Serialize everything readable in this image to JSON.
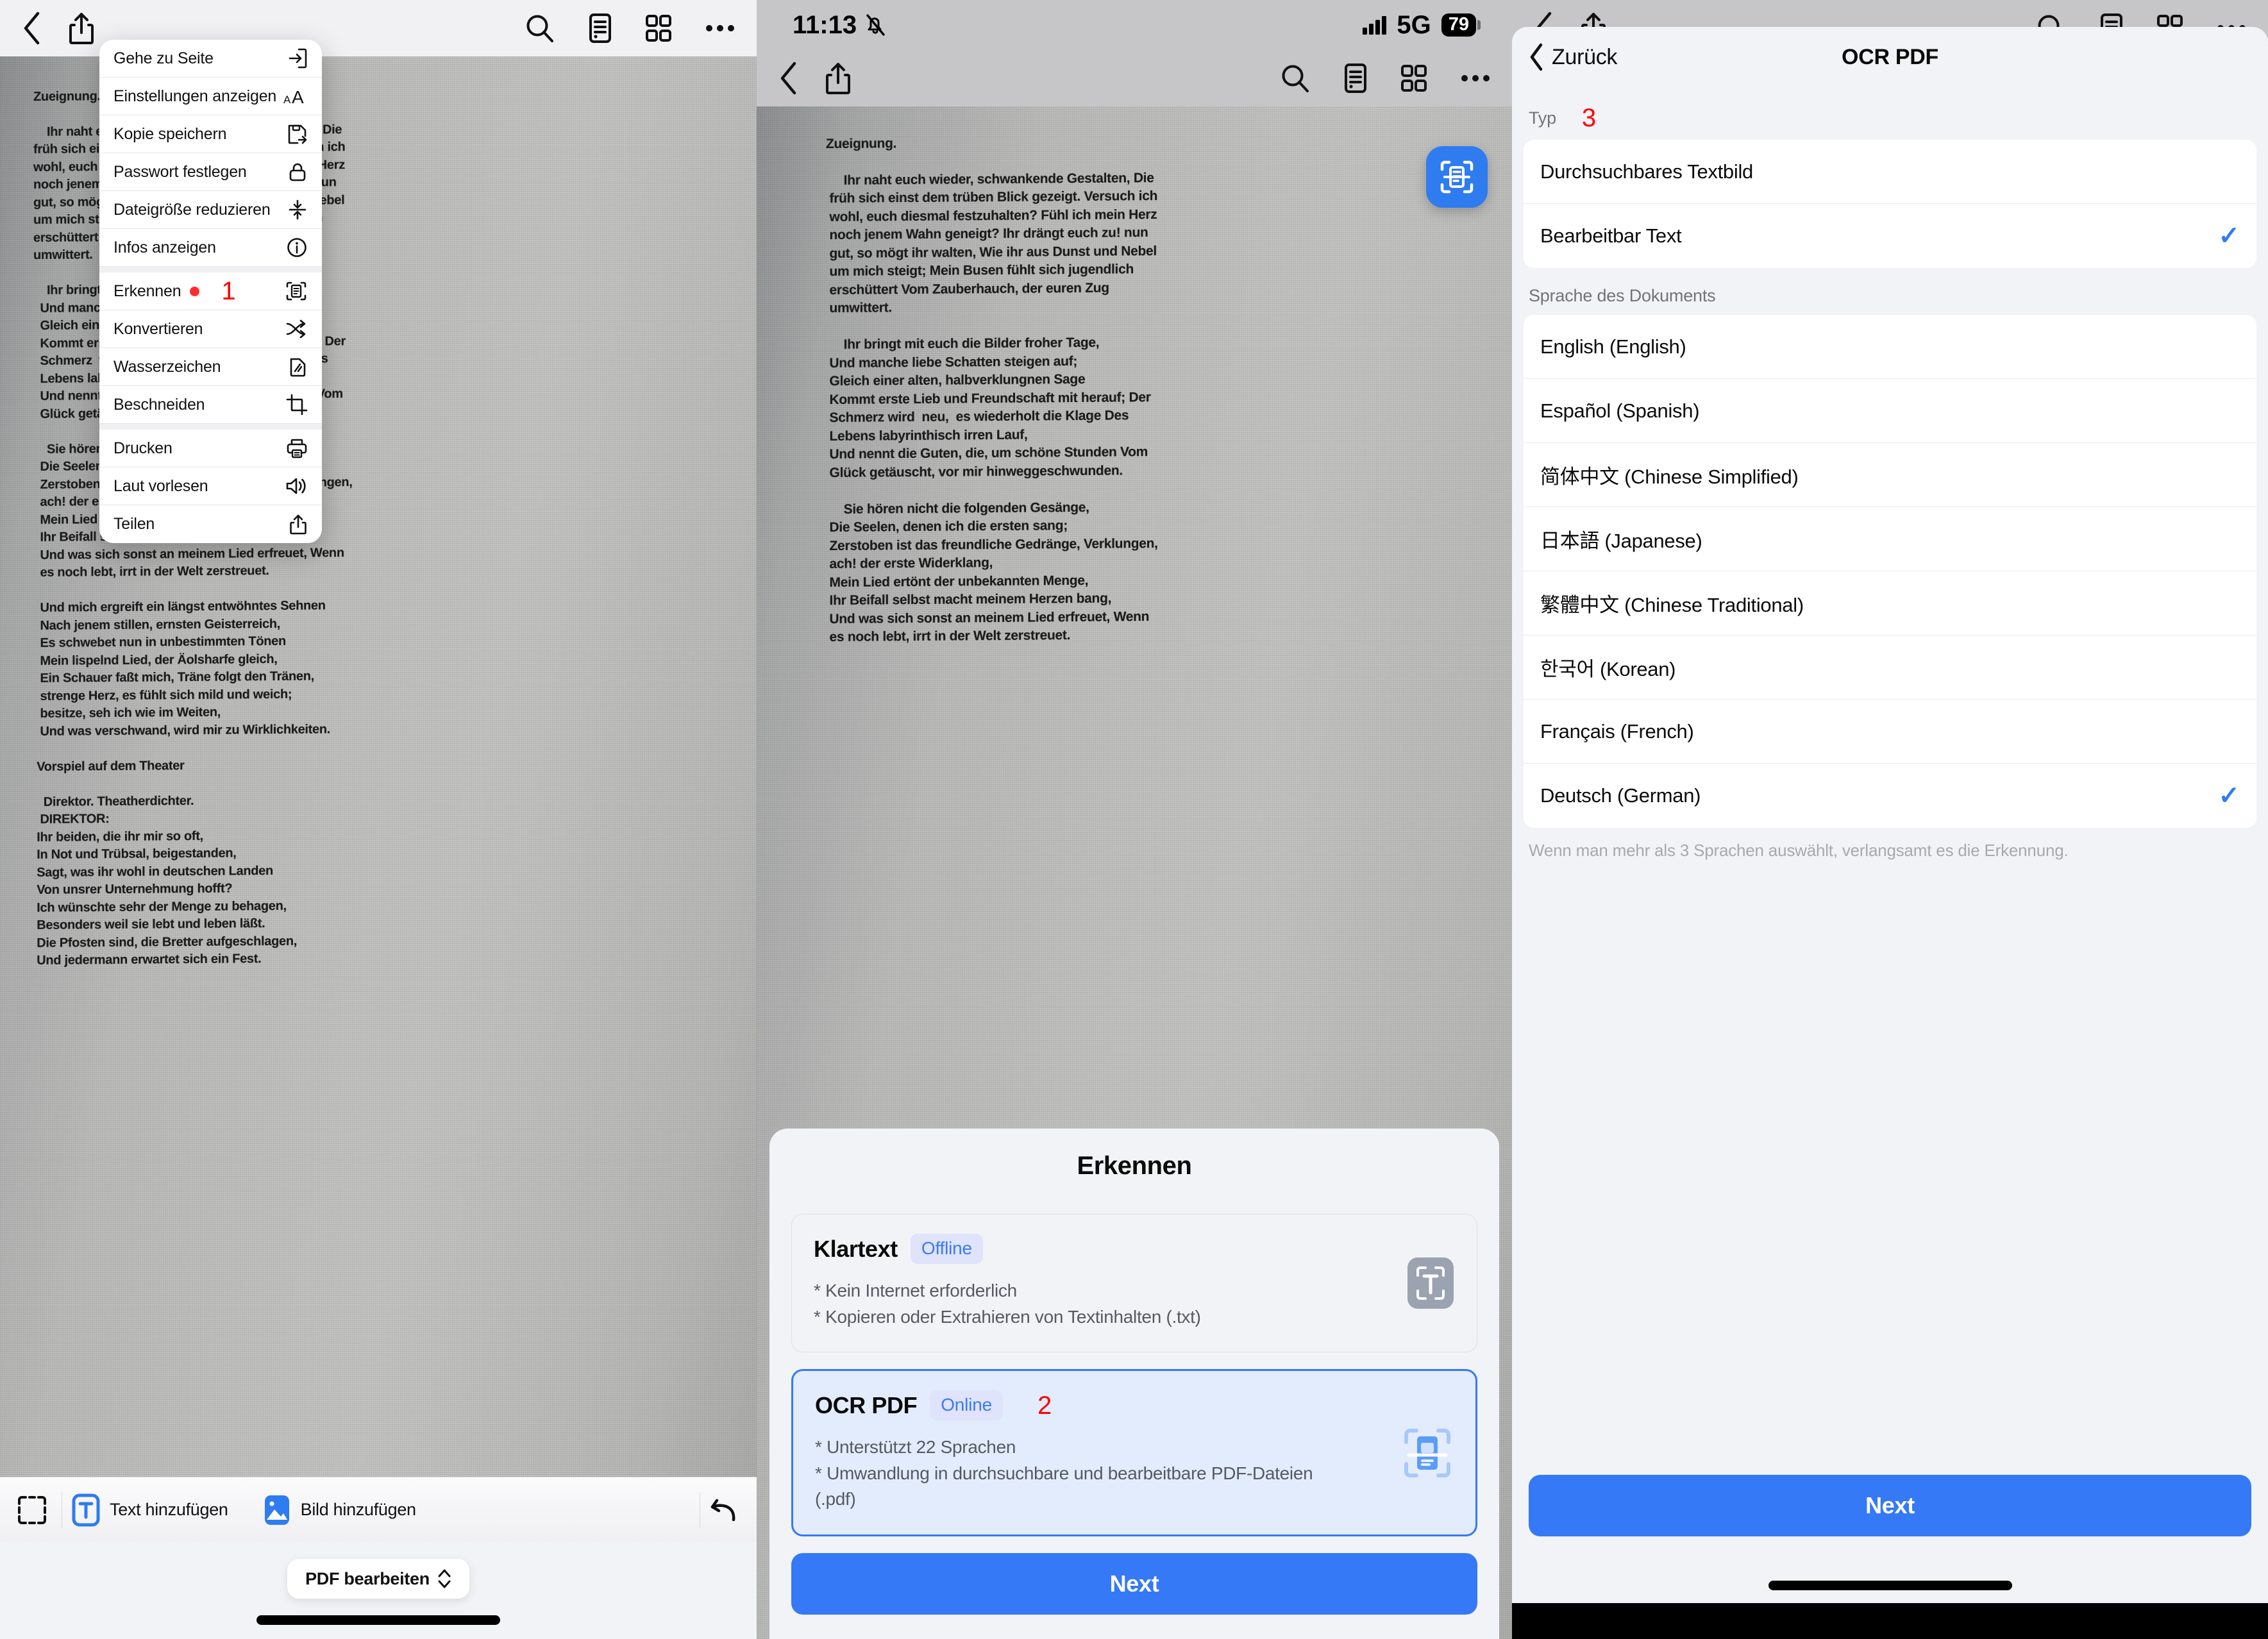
{
  "left_panel": {
    "toolbar": {
      "back": "back-chevron",
      "share": "share-icon",
      "search": "search-icon",
      "outline": "outline-icon",
      "thumbnails": "grid-icon",
      "more": "more-icon"
    },
    "document_text": [
      "Zueignung.",
      "Ihr naht euch wieder, schwankende Gestalten, Die",
      "früh sich einst dem trüben Blick gezeigt. Versuch ich",
      "wohl, euch diesmal festzuhalten? Fühl ich mein Herz",
      "noch jenem Wahn geneigt? Ihr drängt euch zu! nun",
      "gut, so mögt ihr walten, Wie ihr aus Dunst und Nebel",
      "um mich steigt; Mein Busen fühlt sich jugendlich",
      "erschüttert Vom Zauberhauch, der euren Zug",
      "umwittert.",
      "Ihr bringt mit euch die Bilder froher Tage,",
      "Und manche liebe Schatten steigen auf;",
      "Gleich einer alten, halbverklungnen Sage",
      "Kommt erste Lieb und Freundschaft mit herauf; Der",
      "Schmerz wird  neu,  es wiederholt die Klage Des",
      "Lebens labyrinthisch irren Lauf,",
      "Und nennt die Guten, die, um schöne Stunden Vom",
      "Glück getäuscht, vor mir hinweggeschwunden.",
      "Sie hören nicht die folgenden Gesänge,",
      "Die Seelen, denen ich die ersten sang;",
      "Zerstoben ist das freundliche Gedränge, Verklungen,",
      "ach! der erste Widerklang,",
      "Mein Lied ertönt der unbekannten Menge,",
      "Ihr Beifall selbst macht meinem Herzen bang,",
      "Und was sich sonst an meinem Lied erfreuet, Wenn",
      "es noch lebt, irrt in der Welt zerstreuet.",
      "Und mich ergreift ein längst entwöhntes Sehnen",
      "Nach jenem stillen, ernsten Geisterreich,",
      "Es schwebet nun in unbestimmten Tönen",
      "Mein lispelnd Lied, der Äolsharfe gleich,",
      "Ein Schauer faßt mich, Träne folgt den Tränen,",
      "strenge Herz, es fühlt sich mild und weich;",
      "besitze, seh ich wie im Weiten,",
      "Und was verschwand, wird mir zu Wirklichkeiten.",
      "Vorspiel auf dem Theater",
      "Direktor. Theatherdichter.",
      "DIREKTOR:",
      "Ihr beiden, die ihr mir so oft,",
      "In Not und Trübsal, beigestanden,",
      "Sagt, was ihr wohl in deutschen Landen",
      "Von unsrer Unternehmung hofft?",
      "Ich wünschte sehr der Menge zu behagen,",
      "Besonders weil sie lebt und leben läßt.",
      "Die Pfosten sind, die Bretter aufgeschlagen,",
      "Und jedermann erwartet sich ein Fest."
    ],
    "context_menu": {
      "groups": [
        [
          {
            "label": "Gehe zu Seite",
            "icon": "goto-page-icon"
          },
          {
            "label": "Einstellungen anzeigen",
            "icon": "text-size-icon"
          },
          {
            "label": "Kopie speichern",
            "icon": "save-copy-icon"
          },
          {
            "label": "Passwort festlegen",
            "icon": "lock-icon"
          },
          {
            "label": "Dateigröße reduzieren",
            "icon": "compress-icon"
          },
          {
            "label": "Infos anzeigen",
            "icon": "info-icon"
          }
        ],
        [
          {
            "label": "Erkennen",
            "icon": "scan-text-icon",
            "dot": true,
            "step": "1"
          },
          {
            "label": "Konvertieren",
            "icon": "convert-icon"
          },
          {
            "label": "Wasserzeichen",
            "icon": "watermark-icon"
          },
          {
            "label": "Beschneiden",
            "icon": "crop-icon"
          }
        ],
        [
          {
            "label": "Drucken",
            "icon": "printer-icon"
          },
          {
            "label": "Laut vorlesen",
            "icon": "speaker-icon"
          },
          {
            "label": "Teilen",
            "icon": "share-icon"
          }
        ]
      ]
    },
    "edit_toolbar": {
      "select_icon": "select-area-icon",
      "add_text": "Text hinzufügen",
      "add_text_icon": "add-text-icon",
      "add_image": "Bild hinzufügen",
      "add_image_icon": "add-image-icon",
      "undo_icon": "undo-icon"
    },
    "mode_pill": {
      "label": "PDF bearbeiten",
      "icon": "chevron-updown-icon"
    }
  },
  "mid_panel": {
    "status_bar": {
      "time": "11:13",
      "silent_icon": "bell-slash-icon",
      "signal_icon": "signal-bars-icon",
      "network": "5G",
      "battery": "79"
    },
    "toolbar": {
      "back": "back-chevron",
      "share": "share-icon",
      "search": "search-icon",
      "outline": "outline-icon",
      "thumbnails": "grid-icon",
      "more": "more-icon"
    },
    "fab_icon": "scan-text-icon",
    "sheet": {
      "title": "Erkennen",
      "options": [
        {
          "title": "Klartext",
          "badge": "Offline",
          "desc": "* Kein Internet erforderlich\n* Kopieren oder Extrahieren von Textinhalten (.txt)",
          "icon": "text-scan-icon",
          "selected": false,
          "step": ""
        },
        {
          "title": "OCR PDF",
          "badge": "Online",
          "desc": "* Unterstützt 22 Sprachen\n* Umwandlung in durchsuchbare und bearbeitbare PDF-Dateien (.pdf)",
          "icon": "ocr-pdf-icon",
          "selected": true,
          "step": "2"
        }
      ],
      "next": "Next"
    }
  },
  "right_panel": {
    "toolbar": {
      "back": "back-chevron",
      "share": "share-icon",
      "search": "search-icon",
      "outline": "outline-icon",
      "thumbnails": "grid-icon",
      "more": "more-icon"
    },
    "modal": {
      "back_label": "Zurück",
      "title": "OCR PDF",
      "type_section_label": "Typ",
      "type_step": "3",
      "types": [
        {
          "label": "Durchsuchbares Textbild",
          "checked": false
        },
        {
          "label": "Bearbeitbar Text",
          "checked": true
        }
      ],
      "language_section_label": "Sprache des Dokuments",
      "languages": [
        {
          "label": "English (English)",
          "checked": false
        },
        {
          "label": "Español (Spanish)",
          "checked": false
        },
        {
          "label": "简体中文 (Chinese Simplified)",
          "checked": false
        },
        {
          "label": "日本語 (Japanese)",
          "checked": false
        },
        {
          "label": "繁體中文 (Chinese Traditional)",
          "checked": false
        },
        {
          "label": "한국어 (Korean)",
          "checked": false
        },
        {
          "label": "Français (French)",
          "checked": false
        },
        {
          "label": "Deutsch (German)",
          "checked": true
        }
      ],
      "note": "Wenn man mehr als 3 Sprachen auswählt, verlangsamt es die Erkennung.",
      "next": "Next"
    }
  },
  "colors": {
    "accent_blue": "#3579f6",
    "check_blue": "#2f7bf0",
    "badge_bg": "#dfe3fb",
    "step_red": "#ff0000",
    "dot_red": "#ff2d2d"
  }
}
